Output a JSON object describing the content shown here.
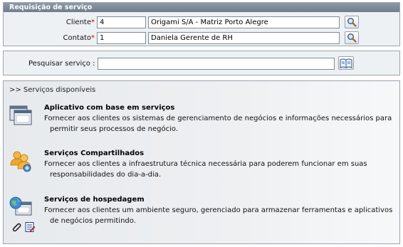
{
  "request": {
    "title": "Requisição de serviço",
    "client": {
      "label": "Cliente",
      "required_mark": "*",
      "code": "4",
      "name": "Origami S/A - Matriz Porto Alegre"
    },
    "contact": {
      "label": "Contato",
      "required_mark": "*",
      "code": "1",
      "name": "Daniela Gerente de RH"
    }
  },
  "search": {
    "label": "Pesquisar serviço :",
    "value": ""
  },
  "services": {
    "title": ">> Serviços disponíveis",
    "items": [
      {
        "name": "Aplicativo com base em serviços",
        "desc_line1": "Fornecer aos clientes os sistemas de gerenciamento de negócios e informações necessários para",
        "desc_line2": "permitir seus processos de negócio.",
        "icon": "application-windows-icon"
      },
      {
        "name": "Serviços Compartilhados",
        "desc_line1": "Fornecer aos clientes a infraestrutura técnica necessária para poderem funcionar em suas",
        "desc_line2": "responsabilidades do dia-a-dia.",
        "icon": "shared-users-icon"
      },
      {
        "name": "Serviços de hospedagem",
        "desc_line1": "Fornecer aos clientes um ambiente seguro, gerenciado para armazenar ferramentas e aplicativos",
        "desc_line2": "de negócios permitindo.",
        "icon": "hosting-globe-icon"
      }
    ],
    "actions": [
      "paperclip-icon",
      "edit-form-icon"
    ]
  }
}
